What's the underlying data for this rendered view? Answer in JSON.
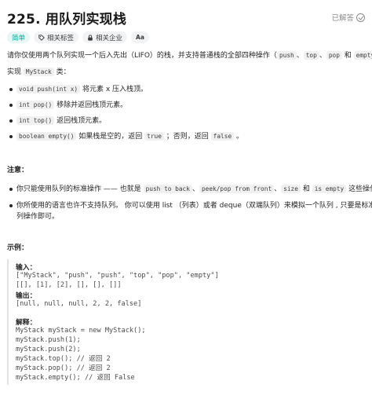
{
  "header": {
    "title": "225. 用队列实现栈",
    "solved_label": "已解答"
  },
  "tags": {
    "difficulty": "简单",
    "related_tags": "相关标签",
    "related_companies": "相关企业",
    "font_toggle": "Aa"
  },
  "description": {
    "intro_1": "请你仅使用两个队列实现一个后入先出（LIFO）的栈，并支持普通栈的全部四种操作（",
    "intro_code_1": "push",
    "intro_sep_1": "、",
    "intro_code_2": "top",
    "intro_sep_2": "、",
    "intro_code_3": "pop",
    "intro_and": " 和 ",
    "intro_code_4": "empty",
    "intro_end": "）。",
    "implement_prefix": "实现 ",
    "implement_code": "MyStack",
    "implement_suffix": " 类：",
    "methods": [
      {
        "code": "void push(int x)",
        "text": " 将元素 x 压入栈顶。"
      },
      {
        "code": "int pop()",
        "text": " 移除并返回栈顶元素。"
      },
      {
        "code": "int top()",
        "text": " 返回栈顶元素。"
      },
      {
        "code": "boolean empty()",
        "text": " 如果栈是空的，返回 ",
        "code2": "true",
        "text2": " ；否则，返回 ",
        "code3": "false",
        "text3": " 。"
      }
    ]
  },
  "notes": {
    "heading": "注意：",
    "note1_prefix": "你只能使用队列的标准操作 —— 也就是 ",
    "note1_code1": "push to back",
    "note1_sep1": "、",
    "note1_code2": "peek/pop from front",
    "note1_sep2": "、",
    "note1_code3": "size",
    "note1_and": " 和 ",
    "note1_code4": "is empty",
    "note1_suffix": " 这些操作。",
    "note2_line1": "你所使用的语言也许不支持队列。 你可以使用 list （列表）或者 deque（双端队列）来模拟一个队列 , 只要是标准的队",
    "note2_line2": "列操作即可。"
  },
  "example": {
    "heading": "示例：",
    "input_label": "输入：",
    "input_line1": "[\"MyStack\", \"push\", \"push\", \"top\", \"pop\", \"empty\"]",
    "input_line2": "[[], [1], [2], [], [], []]",
    "output_label": "输出：",
    "output_line": "[null, null, null, 2, 2, false]",
    "explain_label": "解释：",
    "explain_lines": [
      "MyStack myStack = new MyStack();",
      "myStack.push(1);",
      "myStack.push(2);",
      "myStack.top(); // 返回 2",
      "myStack.pop(); // 返回 2",
      "myStack.empty(); // 返回 False"
    ]
  },
  "colors": {
    "easy": "#00af9b",
    "text": "#262626",
    "muted": "#8c8c8c",
    "code_bg": "#f0f0f0"
  }
}
